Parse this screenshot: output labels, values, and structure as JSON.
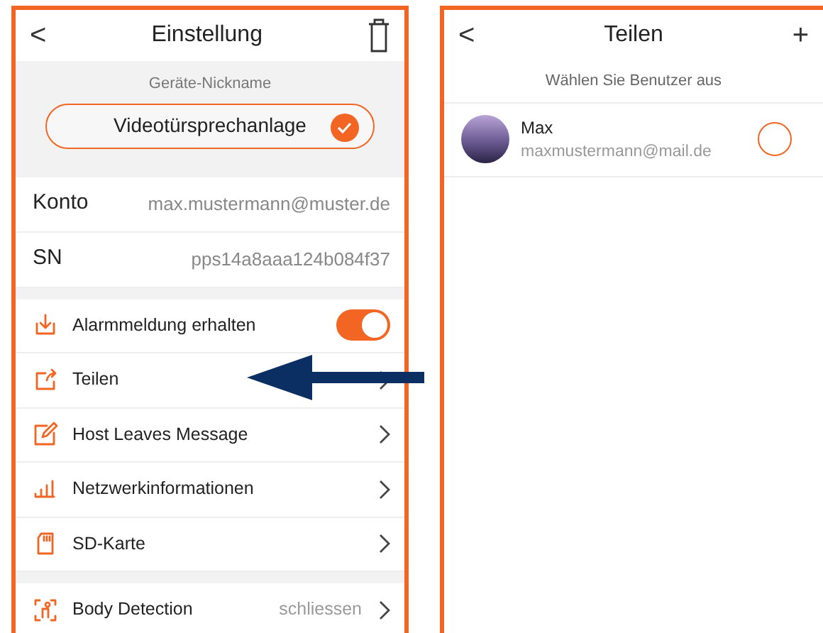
{
  "settings_screen": {
    "header": {
      "back": "<",
      "title": "Einstellung"
    },
    "nickname": {
      "label": "Geräte-Nickname",
      "value": "Videotürsprechanlage",
      "confirmed": true
    },
    "info_rows": [
      {
        "label": "Konto",
        "value": "max.mustermann@muster.de"
      },
      {
        "label": "SN",
        "value": "pps14a8aaa124b084f37"
      }
    ],
    "groups": [
      [
        {
          "kind": "toggle",
          "label": "Alarmmeldung erhalten",
          "on": true
        },
        {
          "kind": "link",
          "label": "Teilen"
        },
        {
          "kind": "link",
          "label": "Host Leaves Message"
        },
        {
          "kind": "link",
          "label": "Netzwerkinformationen"
        },
        {
          "kind": "link",
          "label": "SD-Karte"
        }
      ],
      [
        {
          "kind": "link",
          "label": "Body Detection",
          "value": "schliessen"
        }
      ]
    ]
  },
  "share_screen": {
    "header": {
      "back": "<",
      "title": "Teilen",
      "add": "+"
    },
    "subtitle": "Wählen Sie Benutzer aus",
    "users": [
      {
        "name": "Max",
        "email": "maxmustermann@mail.de",
        "selected": false
      }
    ]
  }
}
